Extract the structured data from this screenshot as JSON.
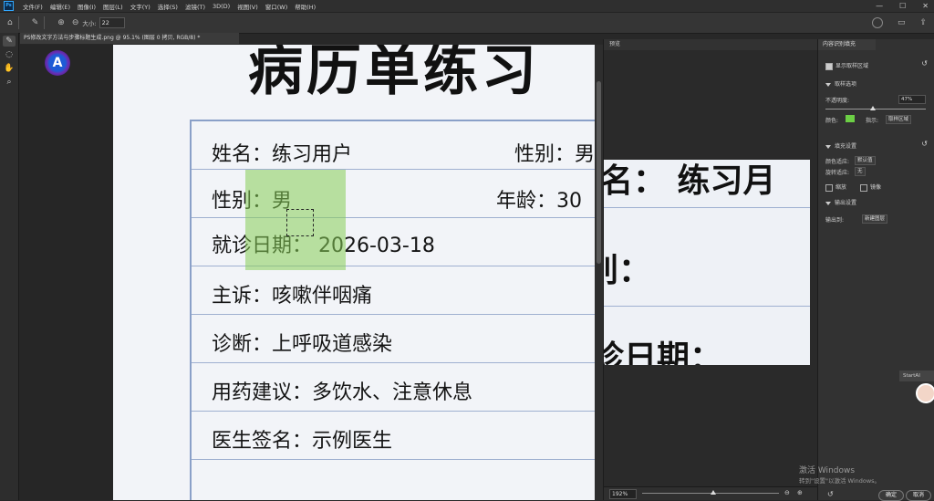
{
  "menubar": {
    "app_icon": "Ps",
    "items": [
      "文件(F)",
      "编辑(E)",
      "图像(I)",
      "图层(L)",
      "文字(Y)",
      "选择(S)",
      "滤镜(T)",
      "3D(D)",
      "视图(V)",
      "窗口(W)",
      "帮助(H)"
    ],
    "window_controls": [
      "—",
      "☐",
      "✕"
    ]
  },
  "options": {
    "size_label": "大小:",
    "size_value": "22"
  },
  "document": {
    "tab_title": "PS修改文字方法与步骤标题生成.png @ 95.1% (图层 0 拷贝, RGB/8) *",
    "title": "病历单练习",
    "rows": [
      {
        "left": "姓名：练习用户",
        "right": "性别：男"
      },
      {
        "left": "性别：男",
        "right": "年龄：30"
      },
      {
        "left": "就诊日期：  2026-03-18",
        "right": ""
      },
      {
        "left": "主诉：咳嗽伴咽痛",
        "right": ""
      },
      {
        "left": "诊断：上呼吸道感染",
        "right": ""
      },
      {
        "left": "用药建议：多饮水、注意休息",
        "right": ""
      },
      {
        "left": "医生签名：示例医生",
        "right": ""
      }
    ]
  },
  "preview": {
    "header": "预览",
    "text_row1": "名：  练习月",
    "text_row2": "别：",
    "text_row3": "诊日期：",
    "zoom": "192%",
    "zoom_fraction": 0.52
  },
  "fill_panel": {
    "tab": "内容识别填充",
    "show_sampling": "显示取样区域",
    "sampling_options": "取样选项",
    "opacity_label": "不透明度:",
    "opacity_value": "47%",
    "opacity_fraction": 0.47,
    "color_label": "颜色:",
    "indicates_label": "指示:",
    "indicates_value": "取样区域",
    "fill_settings": "填充设置",
    "color_adapt_label": "颜色适应:",
    "color_adapt_value": "默认值",
    "rotation_adapt_label": "旋转适应:",
    "rotation_adapt_value": "无",
    "scale_label": "缩放",
    "mirror_label": "镜像",
    "output_settings": "输出设置",
    "output_to_label": "输出到:",
    "output_to_value": "新建图层",
    "ok_label": "确定",
    "cancel_label": "取消",
    "swatch_color": "#6ccf45"
  },
  "overlay": {
    "watermark_line1": "激活 Windows",
    "watermark_line2": "转到\"设置\"以激活 Windows。",
    "startai_label": "StartAI"
  }
}
